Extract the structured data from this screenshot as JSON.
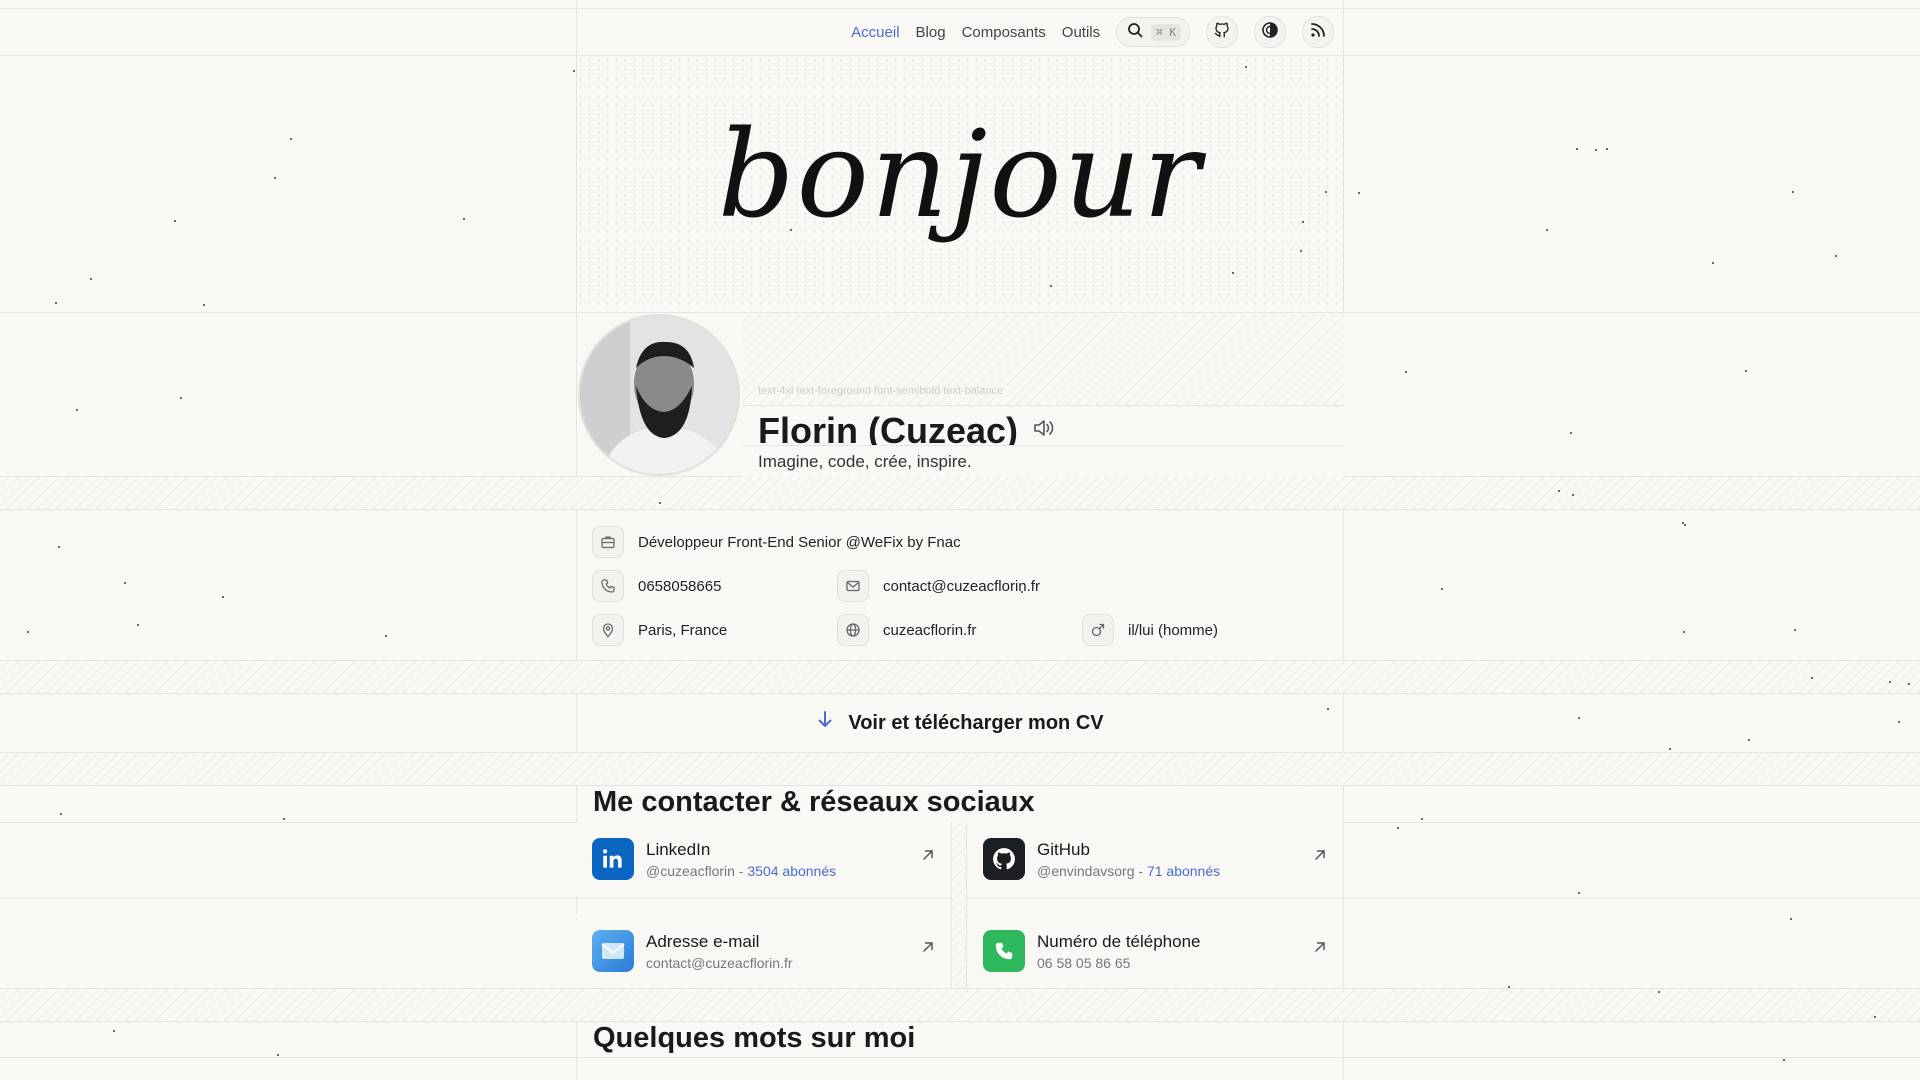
{
  "nav": {
    "items": [
      {
        "label": "Accueil",
        "active": true
      },
      {
        "label": "Blog",
        "active": false
      },
      {
        "label": "Composants",
        "active": false
      },
      {
        "label": "Outils",
        "active": false
      }
    ],
    "search_shortcut": "⌘ K",
    "icons": [
      "search-icon",
      "github-icon",
      "theme-toggle-icon",
      "rss-icon"
    ]
  },
  "hero": {
    "word": "bonjour"
  },
  "profile": {
    "class_hint": "text-4xl text-foreground font-semibold text-balance",
    "name": "Florin (Cuzeac)",
    "tagline": "Imagine, code, crée, inspire."
  },
  "info": {
    "job": "Développeur Front-End Senior @WeFix by Fnac",
    "phone": "0658058665",
    "email": "contact@cuzeacflorin.fr",
    "location": "Paris, France",
    "website": "cuzeacflorin.fr",
    "pronouns": "il/lui (homme)"
  },
  "cv": {
    "label": "Voir et télécharger mon CV"
  },
  "contact": {
    "heading": "Me contacter & réseaux sociaux",
    "cards": [
      {
        "title": "LinkedIn",
        "handle": "@cuzeacflorin",
        "sep": " - ",
        "count": "3504 abonnés"
      },
      {
        "title": "GitHub",
        "handle": "@envindavsorg",
        "sep": " - ",
        "count": "71 abonnés"
      },
      {
        "title": "Adresse e-mail",
        "handle": "contact@cuzeacflorin.fr"
      },
      {
        "title": "Numéro de téléphone",
        "handle": "06 58 05 86 65"
      }
    ]
  },
  "about": {
    "heading": "Quelques mots sur moi"
  },
  "colors": {
    "accent": "#4a6bd1",
    "background": "#f9f8f4",
    "linkedin": "#0a66c2",
    "github": "#1b1f24",
    "email": "#3b8fe0",
    "phone": "#2eb85c"
  }
}
